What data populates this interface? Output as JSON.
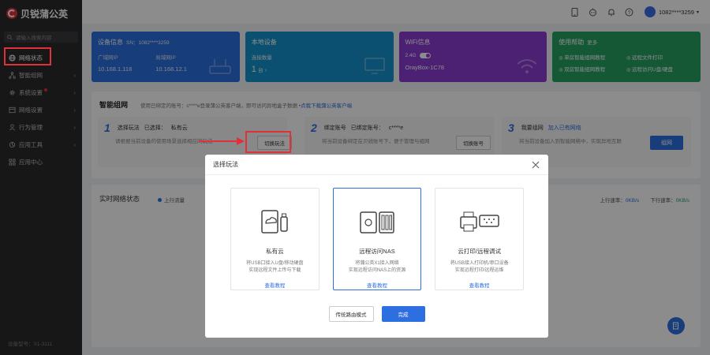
{
  "app": {
    "name": "贝锐蒲公英"
  },
  "sidebar": {
    "search_placeholder": "请输入搜索内容",
    "items": [
      {
        "label": "网络状态",
        "icon": "globe-icon",
        "active": true
      },
      {
        "label": "智能组网",
        "icon": "network-icon"
      },
      {
        "label": "系统设置",
        "icon": "gear-icon",
        "badge": true
      },
      {
        "label": "网络设置",
        "icon": "sliders-icon"
      },
      {
        "label": "行为管理",
        "icon": "user-shield-icon"
      },
      {
        "label": "应用工具",
        "icon": "tools-icon"
      },
      {
        "label": "应用中心",
        "icon": "grid-icon"
      }
    ],
    "device_model": "设备型号：X1-3111"
  },
  "topbar": {
    "user": "1082****3259"
  },
  "cards": {
    "device": {
      "title": "设备信息",
      "sn": "SN：1082****3259",
      "wan_label": "广域网IP",
      "wan_ip": "10.168.1.118",
      "lan_label": "局域网IP",
      "lan_ip": "10.168.12.1"
    },
    "local": {
      "title": "本地设备",
      "count_label": "连接数量",
      "count": "1",
      "unit": "台"
    },
    "wifi": {
      "title": "WiFi信息",
      "band": "2.4G",
      "ssid": "OrayBox-1C78"
    },
    "help": {
      "title": "使用帮助",
      "more": "更多",
      "links": [
        "单房智能组网教程",
        "远程文件打印",
        "双房智能组网教程",
        "远程访问U盘/硬盘"
      ]
    }
  },
  "mesh": {
    "title": "智能组网",
    "subtitle": "使用已绑定的账号：c****e登录蒲公英客户端，即可访问异地盒子数据 •",
    "subtitle_link": "点我下载蒲公英客户端",
    "step1": {
      "title": "选择玩法",
      "selected_label": "已选择：",
      "selected_value": "私有云",
      "desc": "请根据当前设备的使用场景选择相应的玩法",
      "button": "切换玩法"
    },
    "step2": {
      "title": "绑定账号",
      "bound_label": "已绑定账号：",
      "bound_value": "c****e",
      "desc": "将当前设备绑定在贝锐账号下，便于管理与组网",
      "button": "切换账号"
    },
    "step3": {
      "title": "我要组网",
      "link": "加入已有网络",
      "desc": "将当前设备加入到智能网络中，实现异地互联",
      "button": "组网"
    }
  },
  "realtime": {
    "title": "实时网络状态",
    "legend_up": "上行流量",
    "up_label": "上行速率：",
    "up_value": "0KB/s",
    "down_label": "下行速率：",
    "down_value": "0KB/s"
  },
  "modal": {
    "title": "选择玩法",
    "options": [
      {
        "name": "私有云",
        "desc1": "将USB口接入U盘/移动硬盘",
        "desc2": "实现远程文件上传与下载",
        "link": "查看教程"
      },
      {
        "name": "远程访问NAS",
        "desc1": "将蒲公英X1接入网络",
        "desc2": "实现远程访问NAS上的资源",
        "link": "查看教程",
        "selected": true
      },
      {
        "name": "云打印/远程调试",
        "desc1": "将USB接入打印机/串口设备",
        "desc2": "实现远程打印/远程运维",
        "link": "查看教程"
      }
    ],
    "btn_traditional": "传统路由模式",
    "btn_done": "完成"
  },
  "colors": {
    "primary": "#2d6fe0",
    "annotation": "#e0303a",
    "sidebar_bg": "#2b2b2d"
  }
}
